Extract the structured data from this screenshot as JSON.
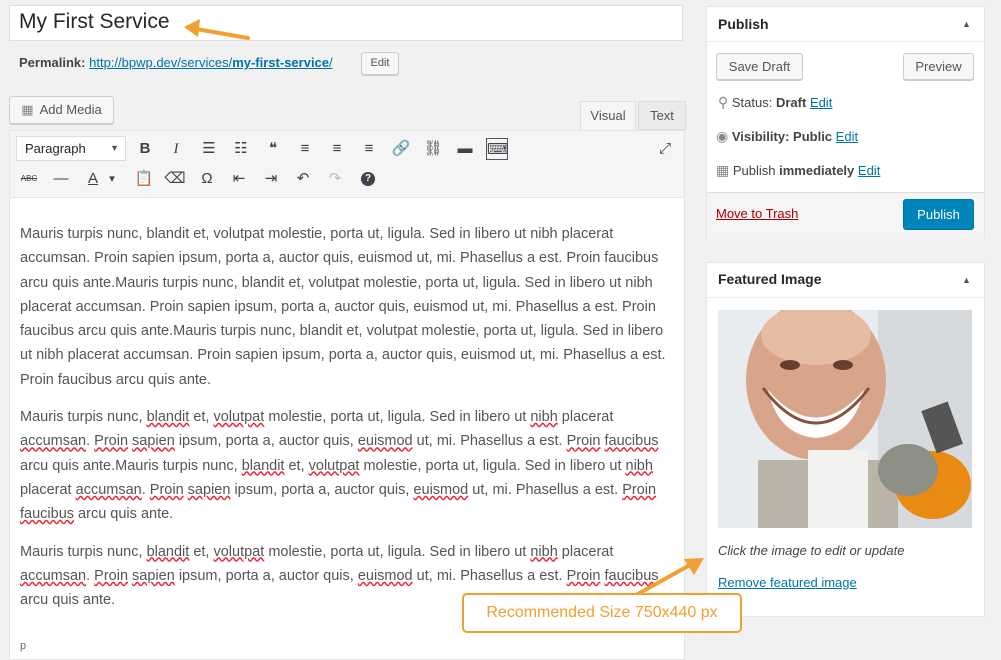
{
  "post": {
    "title": "My First Service",
    "permalink_label": "Permalink:",
    "permalink_base": "http://bpwp.dev/services/",
    "permalink_slug": "my-first-service",
    "permalink_end": "/",
    "edit_slug_label": "Edit"
  },
  "editor": {
    "add_media_label": "Add Media",
    "tabs": {
      "visual": "Visual",
      "text": "Text"
    },
    "format_select": "Paragraph",
    "toolbar_row1": [
      {
        "name": "bold-icon",
        "glyph": "B"
      },
      {
        "name": "italic-icon",
        "glyph": "I"
      },
      {
        "name": "bullet-list-icon",
        "glyph": "☰"
      },
      {
        "name": "numbered-list-icon",
        "glyph": "☷"
      },
      {
        "name": "blockquote-icon",
        "glyph": "❝"
      },
      {
        "name": "align-left-icon",
        "glyph": "≡"
      },
      {
        "name": "align-center-icon",
        "glyph": "≡"
      },
      {
        "name": "align-right-icon",
        "glyph": "≡"
      },
      {
        "name": "insert-link-icon",
        "glyph": "🔗"
      },
      {
        "name": "unlink-icon",
        "glyph": "⛓"
      },
      {
        "name": "read-more-icon",
        "glyph": "▬"
      },
      {
        "name": "toolbar-toggle-icon",
        "glyph": "⌨"
      }
    ],
    "toolbar_row2": [
      {
        "name": "strikethrough-icon",
        "glyph": "ABC"
      },
      {
        "name": "horizontal-line-icon",
        "glyph": "—"
      },
      {
        "name": "text-color-icon",
        "glyph": "A"
      },
      {
        "name": "text-color-dropdown-icon",
        "glyph": "▾"
      },
      {
        "name": "paste-text-icon",
        "glyph": "📋"
      },
      {
        "name": "clear-formatting-icon",
        "glyph": "⌫"
      },
      {
        "name": "special-character-icon",
        "glyph": "Ω"
      },
      {
        "name": "outdent-icon",
        "glyph": "⇤"
      },
      {
        "name": "indent-icon",
        "glyph": "⇥"
      },
      {
        "name": "undo-icon",
        "glyph": "↶"
      },
      {
        "name": "redo-icon",
        "glyph": "↷"
      },
      {
        "name": "help-icon",
        "glyph": "?"
      }
    ],
    "distraction_free_icon": "⤢",
    "paragraph1": "Mauris turpis nunc, blandit et, volutpat molestie, porta ut, ligula. Sed in libero ut nibh placerat accumsan. Proin sapien ipsum, porta a, auctor quis, euismod ut, mi. Phasellus a est. Proin faucibus arcu quis ante.Mauris turpis nunc, blandit et, volutpat molestie, porta ut, ligula. Sed in libero ut nibh placerat accumsan. Proin sapien ipsum, porta a, auctor quis, euismod ut, mi. Phasellus a est. Proin faucibus arcu quis ante.Mauris turpis nunc, blandit et, volutpat molestie, porta ut, ligula. Sed in libero ut nibh placerat accumsan. Proin sapien ipsum, porta a, auctor quis, euismod ut, mi. Phasellus a est. Proin faucibus arcu quis ante.",
    "paragraph2": "Mauris turpis nunc, blandit et, volutpat molestie, porta ut, ligula. Sed in libero ut nibh placerat accumsan. Proin sapien ipsum, porta a, auctor quis, euismod ut, mi. Phasellus a est. Proin faucibus arcu quis ante.Mauris turpis nunc, blandit et, volutpat molestie, porta ut, ligula. Sed in libero ut nibh placerat accumsan. Proin sapien ipsum, porta a, auctor quis, euismod ut, mi. Phasellus a est. Proin faucibus arcu quis ante.",
    "paragraph3": "Mauris turpis nunc, blandit et, volutpat molestie, porta ut, ligula. Sed in libero ut nibh placerat accumsan. Proin sapien ipsum, porta a, auctor quis, euismod ut, mi. Phasellus a est. Proin faucibus arcu quis ante.",
    "spellcheck_words": [
      "blandit",
      "volutpat",
      "nibh",
      "accumsan",
      "Proin",
      "sapien",
      "euismod",
      "faucibus"
    ],
    "path": "p"
  },
  "publish": {
    "title": "Publish",
    "save_draft": "Save Draft",
    "preview": "Preview",
    "status_label": "Status:",
    "status_value": "Draft",
    "visibility_label": "Visibility:",
    "visibility_value": "Public",
    "publish_label": "Publish",
    "publish_value": "immediately",
    "edit_label": "Edit",
    "trash_label": "Move to Trash",
    "publish_button": "Publish"
  },
  "featured_image": {
    "title": "Featured Image",
    "caption": "Click the image to edit or update",
    "remove_label": "Remove featured image"
  },
  "annotation": {
    "callout": "Recommended Size 750x440 px"
  },
  "colors": {
    "link": "#0073aa",
    "publish_button": "#0085ba",
    "trash": "#aa0000",
    "annotation": "#f0a030"
  }
}
